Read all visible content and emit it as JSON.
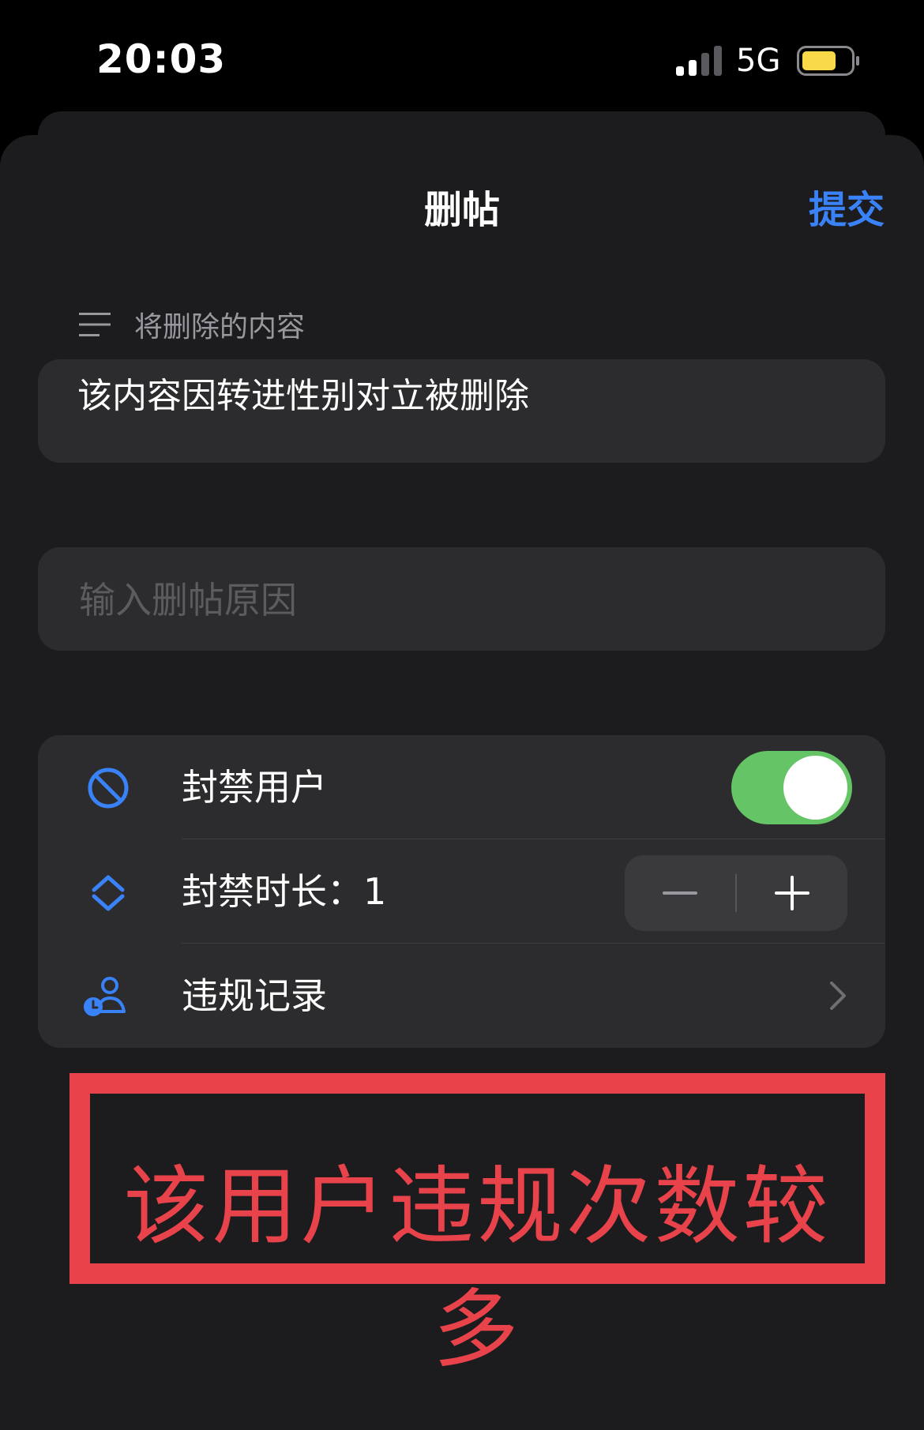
{
  "status_bar": {
    "time": "20:03",
    "network": "5G",
    "battery_level": 0.7,
    "battery_color": "#f9d948",
    "signal_bars_active": 2
  },
  "nav": {
    "title": "删帖",
    "submit_label": "提交"
  },
  "delete_section": {
    "header_icon": "text-lines-icon",
    "header": "将删除的内容",
    "content": "该内容因转进性别对立被删除"
  },
  "reason_input": {
    "placeholder": "输入删帖原因",
    "value": ""
  },
  "settings": {
    "ban_user": {
      "icon": "prohibited-icon",
      "label": "封禁用户",
      "enabled": true
    },
    "ban_duration": {
      "icon": "up-down-icon",
      "label": "封禁时长：1",
      "value": 1
    },
    "violation_records": {
      "icon": "person-clock-icon",
      "label": "违规记录"
    }
  },
  "warning_annotation": {
    "text": "该用户违规次数较多",
    "color": "#e8434b"
  },
  "colors": {
    "accent": "#3a82f7",
    "toggle_on": "#65c466",
    "sheet_bg": "#1c1c1e",
    "card_bg": "#2c2c2e"
  }
}
